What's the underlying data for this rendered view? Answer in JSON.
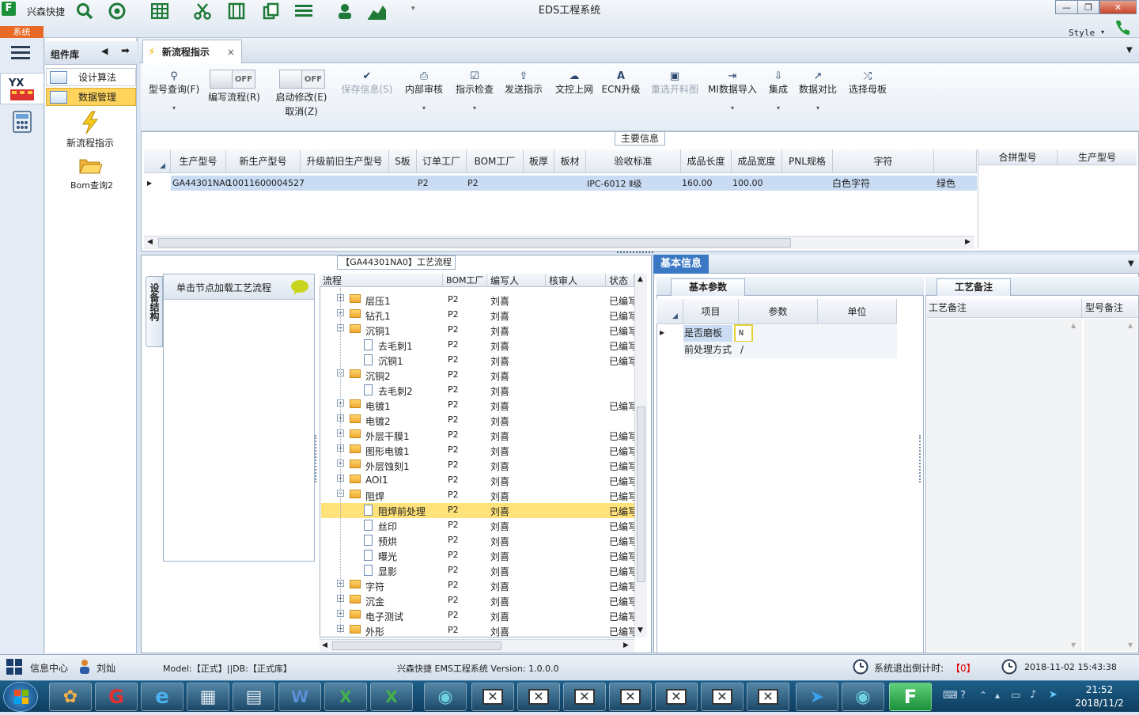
{
  "titlebar": {
    "app_name": "兴森快捷",
    "window_title": "EDS工程系统",
    "minimize": "—",
    "restore": "❐",
    "close": "✕",
    "style_label": "Style"
  },
  "sys_tab": "系统",
  "component_lib": {
    "title": "组件库",
    "items": [
      "设计算法",
      "数据管理"
    ],
    "tools": [
      "新流程指示",
      "Bom查询2"
    ]
  },
  "doc_tab": {
    "label": "新流程指示",
    "close": "×"
  },
  "ribbon": {
    "query": "型号查询(F)",
    "write_flow": "编写流程(R)",
    "start_modify": "启动修改(E)",
    "cancel": "取消(Z)",
    "toggle_off": "OFF",
    "save": "保存信息(S)",
    "internal_review": "内部审核",
    "check": "指示检查",
    "send": "发送指示",
    "doc_upload": "文控上网",
    "ecn": "ECN升级",
    "reselect": "重选开料图",
    "mi_import": "MI数据导入",
    "integrate": "集成",
    "compare": "数据对比",
    "select_mother": "选择母板"
  },
  "main_info": {
    "title": "主要信息",
    "columns": [
      "生产型号",
      "新生产型号",
      "升级前旧生产型号",
      "S板",
      "订单工厂",
      "BOM工厂",
      "板厚",
      "板材",
      "验收标准",
      "成品长度",
      "成品宽度",
      "PNL规格",
      "字符"
    ],
    "row": {
      "model": "GA44301NA0",
      "new_model": "10011600004527",
      "order_factory": "P2",
      "bom_factory": "P2",
      "standard": "IPC-6012 Ⅱ级",
      "length": "160.00",
      "width": "100.00",
      "char": "白色字符",
      "color": "绿色"
    },
    "right_columns": [
      "合拼型号",
      "生产型号"
    ]
  },
  "process": {
    "title": "【GA44301NA0】工艺流程",
    "side_tab": "设备结构",
    "hint": "单击节点加载工艺流程",
    "columns": [
      "流程",
      "BOM工厂",
      "编写人",
      "核审人",
      "状态"
    ],
    "rows": [
      {
        "name": "层压1",
        "level": 0,
        "type": "folder",
        "bom": "P2",
        "writer": "刘喜",
        "status": "已编写"
      },
      {
        "name": "钻孔1",
        "level": 0,
        "type": "folder",
        "bom": "P2",
        "writer": "刘喜",
        "status": "已编写"
      },
      {
        "name": "沉铜1",
        "level": 0,
        "type": "folder-open",
        "bom": "P2",
        "writer": "刘喜",
        "status": "已编写"
      },
      {
        "name": "去毛刺1",
        "level": 1,
        "type": "page",
        "bom": "P2",
        "writer": "刘喜",
        "status": "已编写"
      },
      {
        "name": "沉铜1",
        "level": 1,
        "type": "page",
        "bom": "P2",
        "writer": "刘喜",
        "status": "已编写"
      },
      {
        "name": "沉铜2",
        "level": 0,
        "type": "folder-open",
        "bom": "P2",
        "writer": "刘喜",
        "status": ""
      },
      {
        "name": "去毛刺2",
        "level": 1,
        "type": "page",
        "bom": "P2",
        "writer": "刘喜",
        "status": ""
      },
      {
        "name": "电镀1",
        "level": 0,
        "type": "folder",
        "bom": "P2",
        "writer": "刘喜",
        "status": "已编写"
      },
      {
        "name": "电镀2",
        "level": 0,
        "type": "folder",
        "bom": "P2",
        "writer": "刘喜",
        "status": ""
      },
      {
        "name": "外层干膜1",
        "level": 0,
        "type": "folder",
        "bom": "P2",
        "writer": "刘喜",
        "status": "已编写"
      },
      {
        "name": "图形电镀1",
        "level": 0,
        "type": "folder",
        "bom": "P2",
        "writer": "刘喜",
        "status": "已编写"
      },
      {
        "name": "外层蚀刻1",
        "level": 0,
        "type": "folder",
        "bom": "P2",
        "writer": "刘喜",
        "status": "已编写"
      },
      {
        "name": "AOI1",
        "level": 0,
        "type": "folder",
        "bom": "P2",
        "writer": "刘喜",
        "status": "已编写"
      },
      {
        "name": "阻焊",
        "level": 0,
        "type": "folder-open",
        "bom": "P2",
        "writer": "刘喜",
        "status": "已编写"
      },
      {
        "name": "阻焊前处理",
        "level": 1,
        "type": "page",
        "bom": "P2",
        "writer": "刘喜",
        "status": "已编写",
        "selected": true
      },
      {
        "name": "丝印",
        "level": 1,
        "type": "page",
        "bom": "P2",
        "writer": "刘喜",
        "status": "已编写"
      },
      {
        "name": "预烘",
        "level": 1,
        "type": "page",
        "bom": "P2",
        "writer": "刘喜",
        "status": "已编写"
      },
      {
        "name": "曝光",
        "level": 1,
        "type": "page",
        "bom": "P2",
        "writer": "刘喜",
        "status": "已编写"
      },
      {
        "name": "显影",
        "level": 1,
        "type": "page",
        "bom": "P2",
        "writer": "刘喜",
        "status": "已编写"
      },
      {
        "name": "字符",
        "level": 0,
        "type": "folder",
        "bom": "P2",
        "writer": "刘喜",
        "status": "已编写"
      },
      {
        "name": "沉金",
        "level": 0,
        "type": "folder",
        "bom": "P2",
        "writer": "刘喜",
        "status": "已编写"
      },
      {
        "name": "电子测试",
        "level": 0,
        "type": "folder",
        "bom": "P2",
        "writer": "刘喜",
        "status": "已编写"
      },
      {
        "name": "外形",
        "level": 0,
        "type": "folder",
        "bom": "P2",
        "writer": "刘喜",
        "status": "已编写"
      }
    ]
  },
  "basic_info": {
    "title": "基本信息",
    "params_tab": "基本参数",
    "columns": [
      "项目",
      "参数",
      "单位"
    ],
    "rows": [
      {
        "item": "是否磨板",
        "value": "N",
        "unit": ""
      },
      {
        "item": "前处理方式",
        "value": "/",
        "unit": ""
      }
    ]
  },
  "craft_notes": {
    "tab": "工艺备注",
    "col1": "工艺备注",
    "col2": "型号备注"
  },
  "status_bar": {
    "info_center": "信息中心",
    "user": "刘灿",
    "model_db": "Model:【正式】||DB:【正式库】",
    "app_version": "兴森快捷 EMS工程系统 Version: 1.0.0.0",
    "countdown_label": "系统退出倒计时:",
    "countdown_value": "【0】",
    "datetime": "2018-11-02 15:43:38"
  },
  "taskbar": {
    "time": "21:52",
    "date": "2018/11/2"
  },
  "colors": {
    "accent_blue": "#3a78c4",
    "selection_yellow": "#ffe27a",
    "sys_tab_orange": "#e86a24",
    "countdown_red": "#e00000"
  }
}
